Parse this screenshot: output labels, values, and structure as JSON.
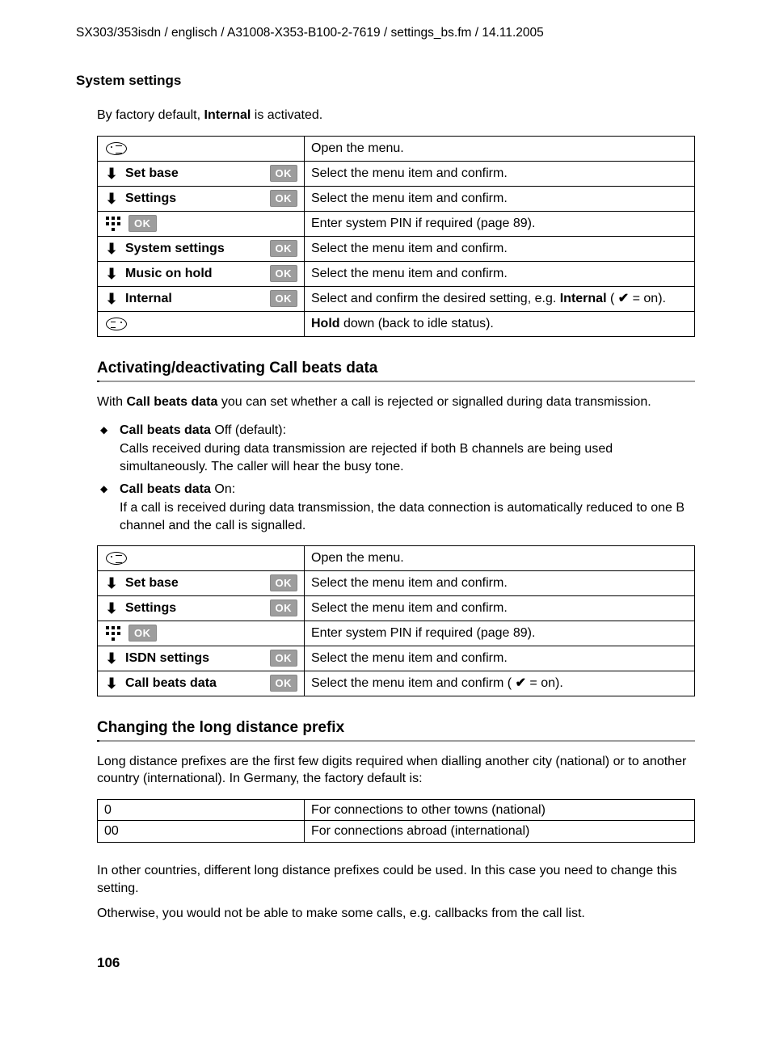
{
  "header": "SX303/353isdn / englisch / A31008-X353-B100-2-7619 / settings_bs.fm / 14.11.2005",
  "section_title": "System settings",
  "intro_prefix": "By factory default, ",
  "intro_bold": "Internal",
  "intro_suffix": " is activated.",
  "ok_label": "OK",
  "table1": {
    "r0_desc": "Open the menu.",
    "r1_label": "Set base",
    "r1_desc": "Select the menu item and confirm.",
    "r2_label": "Settings",
    "r2_desc": "Select the menu item and confirm.",
    "r3_desc": "Enter system PIN if required (page 89).",
    "r4_label": "System settings",
    "r4_desc": "Select the menu item and confirm.",
    "r5_label": "Music on hold",
    "r5_desc": "Select the menu item and confirm.",
    "r6_label": "Internal",
    "r6_desc_a": "Select and confirm the desired setting, e.g. ",
    "r6_desc_b": "Internal",
    "r6_desc_c": " ( ",
    "r6_desc_d": " = on).",
    "r7_desc_a": "Hold",
    "r7_desc_b": " down (back to idle status)."
  },
  "h2a": "Activating/deactivating Call beats data",
  "cb_intro_a": "With ",
  "cb_intro_b": "Call beats data",
  "cb_intro_c": " you can set whether a call is rejected or signalled during data transmission.",
  "bullets": {
    "b1_bold": "Call beats data",
    "b1_rest": " Off (default):",
    "b1_sub": "Calls received during data transmission are rejected if both B channels are being used simultaneously. The caller will hear the busy tone.",
    "b2_bold": "Call beats data",
    "b2_rest": " On:",
    "b2_sub": "If a call is received during data transmission, the data connection is automatically reduced to one B channel and the call is signalled."
  },
  "table2": {
    "r0_desc": "Open the menu.",
    "r1_label": "Set base",
    "r1_desc": "Select the menu item and confirm.",
    "r2_label": "Settings",
    "r2_desc": "Select the menu item and confirm.",
    "r3_desc": "Enter system PIN if required (page 89).",
    "r4_label": "ISDN settings",
    "r4_desc": "Select the menu item and confirm.",
    "r5_label": "Call beats data",
    "r5_desc_a": "Select the menu item and confirm ( ",
    "r5_desc_b": " = on)."
  },
  "h2b": "Changing the long distance prefix",
  "ld_intro": "Long distance prefixes are the first few digits required when dialling another city (national) or to another country (international). In Germany, the factory default is:",
  "prefix_table": {
    "r0_a": "0",
    "r0_b": "For connections to other towns (national)",
    "r1_a": "00",
    "r1_b": "For connections abroad (international)"
  },
  "ld_p1": "In other countries, different long distance prefixes could be used. In this case you need to change this setting.",
  "ld_p2": "Otherwise, you would not be able to make some calls, e.g. callbacks from the call list.",
  "page_number": "106"
}
